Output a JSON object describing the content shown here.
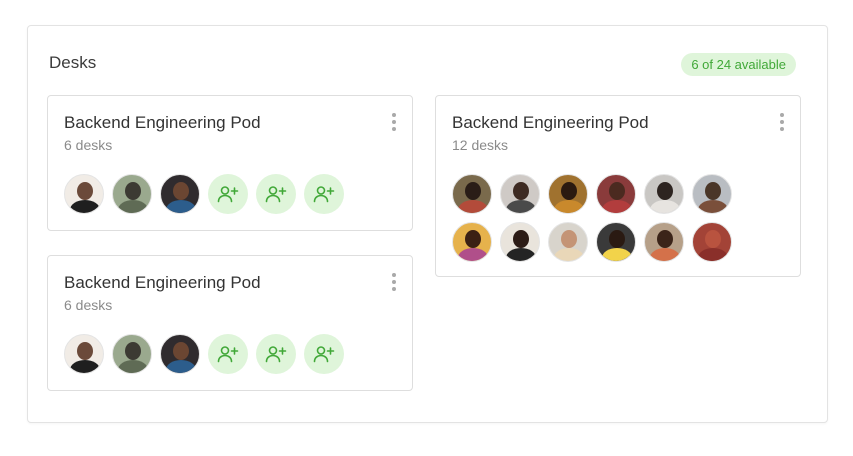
{
  "panel": {
    "title": "Desks",
    "availability_badge": "6 of 24 available"
  },
  "colors": {
    "accent_green": "#41a838",
    "badge_bg": "#dff5da",
    "border": "#dedede"
  },
  "pods": [
    {
      "name": "Backend Engineering Pod",
      "desks": "6 desks",
      "occupants": [
        "person-1",
        "person-2",
        "person-3"
      ],
      "open_slots": 3
    },
    {
      "name": "Backend Engineering Pod",
      "desks": "6 desks",
      "occupants": [
        "person-1",
        "person-2",
        "person-3"
      ],
      "open_slots": 3
    },
    {
      "name": "Backend Engineering Pod",
      "desks": "12 desks",
      "occupants": [
        "person-4",
        "person-5",
        "person-6",
        "person-7",
        "person-8",
        "person-9",
        "person-10",
        "person-11",
        "person-12",
        "person-13",
        "person-14",
        "person-15"
      ],
      "open_slots": 0
    }
  ],
  "icons": {
    "more": "kebab-vertical-icon",
    "add": "add-person-icon"
  }
}
